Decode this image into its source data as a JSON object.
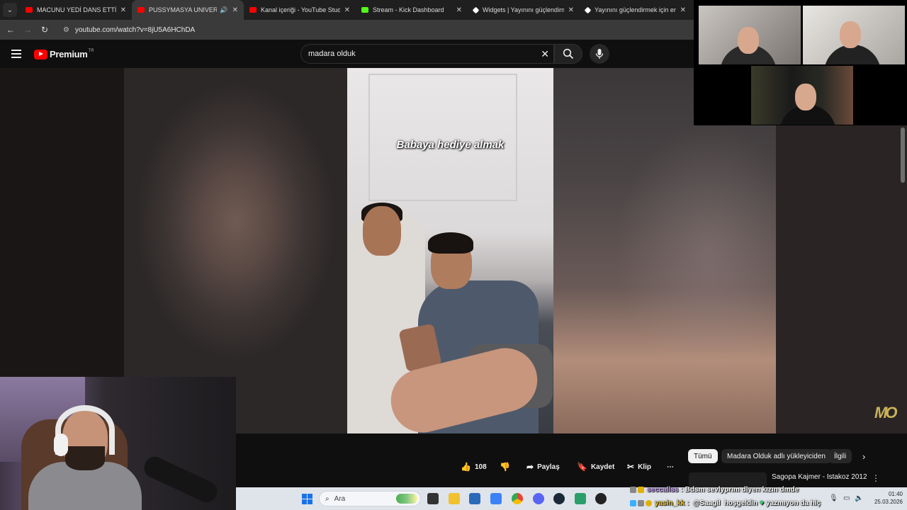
{
  "tabs": [
    {
      "title": "MACUNU YEDİ DANS ETTİ VS !",
      "favicon_color": "#ff0000",
      "active": false
    },
    {
      "title": "PUSSYMASYA UNIVERSITY",
      "favicon_color": "#ff0000",
      "active": true,
      "audio": true
    },
    {
      "title": "Kanal içeriği - YouTube Studio",
      "favicon_color": "#ff0000",
      "active": false
    },
    {
      "title": "Stream - Kick Dashboard",
      "favicon_color": "#53fc18",
      "active": false
    },
    {
      "title": "Widgets | Yayınını güçlendirme",
      "favicon_color": "#ffffff",
      "active": false
    },
    {
      "title": "Yayınını güçlendirmek için en iy",
      "favicon_color": "#ffffff",
      "active": false
    }
  ],
  "address_bar": {
    "url": "youtube.com/watch?v=8jU5A6HChDA"
  },
  "masthead": {
    "logo_text": "Premium",
    "country_code": "TR",
    "search_value": "madara olduk"
  },
  "video": {
    "caption": "Babaya hediye almak",
    "watermark": "MO"
  },
  "actions": {
    "like_count": "108",
    "share_label": "Paylaş",
    "save_label": "Kaydet",
    "clip_label": "Klip",
    "more_label": "⋯"
  },
  "chips": [
    {
      "label": "Tümü",
      "selected": true
    },
    {
      "label": "Madara Olduk adlı yükleyiciden",
      "selected": false
    },
    {
      "label": "İlgili",
      "selected": false
    }
  ],
  "recommendation": {
    "title": "Sagopa Kajmer - Istakoz 2012"
  },
  "taskbar": {
    "search_placeholder": "Ara",
    "time": "01:40",
    "date": "25.03.2026"
  },
  "chat": [
    {
      "user": "seccallss",
      "user_color": "#c89cff",
      "message": ": Bdsm sevlyprım dlyen kızın dmde"
    },
    {
      "user": "yasin_kk",
      "user_color": "#f5c518",
      "mention": "@Saagil",
      "message": "hoşgeldin",
      "extra": "yazmıyon da hiç"
    }
  ],
  "colors": {
    "youtube_red": "#ff0000",
    "kick_green": "#53fc18",
    "background": "#0f0f0f"
  }
}
